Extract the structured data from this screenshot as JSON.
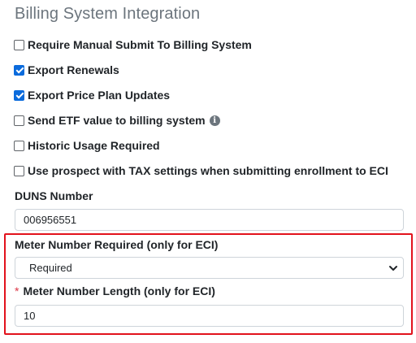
{
  "section": {
    "title": "Billing System Integration"
  },
  "options": [
    {
      "label": "Require Manual Submit To Billing System",
      "checked": false
    },
    {
      "label": "Export Renewals",
      "checked": true
    },
    {
      "label": "Export Price Plan Updates",
      "checked": true
    },
    {
      "label": "Send ETF value to billing system",
      "checked": false,
      "info_icon": "info-circle-icon"
    },
    {
      "label": "Historic Usage Required",
      "checked": false
    },
    {
      "label": "Use prospect with TAX settings when submitting enrollment to ECI",
      "checked": false
    }
  ],
  "duns": {
    "label": "DUNS Number",
    "value": "006956551"
  },
  "meter_required": {
    "label": "Meter Number Required (only for ECI)",
    "selected": "Required"
  },
  "meter_length": {
    "required_mark": "*",
    "label": "Meter Number Length (only for ECI)",
    "value": "10"
  },
  "colors": {
    "accent": "#0b6bdc",
    "highlight": "#e2121c",
    "required": "#dc3545"
  }
}
